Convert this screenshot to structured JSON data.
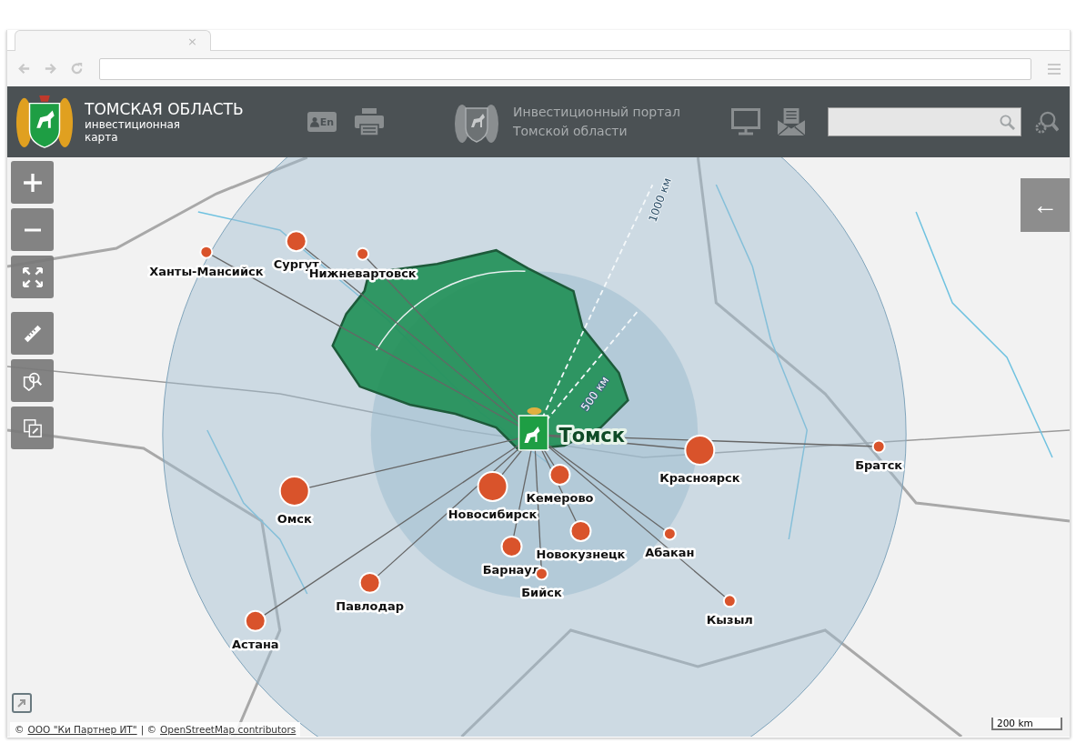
{
  "browser": {
    "tab_close": "×"
  },
  "header": {
    "title": "ТОМСКАЯ ОБЛАСТЬ",
    "subtitle": "инвестиционная карта",
    "lang_button": "En",
    "portal": "Инвестиционный портал Томской области"
  },
  "map": {
    "distance_rings": [
      {
        "label": "500 км"
      },
      {
        "label": "1000 км"
      }
    ],
    "home_city": "Томск",
    "cities": [
      {
        "name": "Ханты-Мансийск",
        "kind": "small"
      },
      {
        "name": "Сургут",
        "kind": "medium"
      },
      {
        "name": "Нижневартовск",
        "kind": "small"
      },
      {
        "name": "Омск",
        "kind": "large"
      },
      {
        "name": "Новосибирск",
        "kind": "large"
      },
      {
        "name": "Кемерово",
        "kind": "medium"
      },
      {
        "name": "Красноярск",
        "kind": "large"
      },
      {
        "name": "Братск",
        "kind": "small"
      },
      {
        "name": "Абакан",
        "kind": "small"
      },
      {
        "name": "Новокузнецк",
        "kind": "medium"
      },
      {
        "name": "Барнаул",
        "kind": "medium"
      },
      {
        "name": "Бийск",
        "kind": "small"
      },
      {
        "name": "Павлодар",
        "kind": "medium"
      },
      {
        "name": "Астана",
        "kind": "medium"
      },
      {
        "name": "Кызыл",
        "kind": "small"
      }
    ],
    "expand_button": "←",
    "attribution": {
      "prefix": "©",
      "owner": "ООО \"Ки Партнер ИТ\"",
      "separator": "| ©",
      "osm": "OpenStreetMap contributors"
    },
    "scale": "200 km"
  }
}
